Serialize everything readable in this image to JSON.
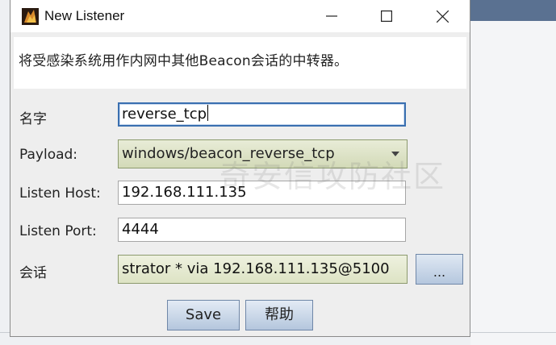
{
  "window": {
    "title": "New Listener",
    "icon": "cobalt-strike-app-icon",
    "controls": [
      "minimize-icon",
      "maximize-icon",
      "close-icon"
    ]
  },
  "description": "将受感染系统用作内网中其他Beacon会话的中转器。",
  "form": {
    "name_label": "名字",
    "name_value": "reverse_tcp",
    "payload_label": "Payload:",
    "payload_value": "windows/beacon_reverse_tcp",
    "listen_host_label": "Listen Host:",
    "listen_host_value": "192.168.111.135",
    "listen_port_label": "Listen Port:",
    "listen_port_value": "4444",
    "session_label": "会话",
    "session_value": "strator * via  192.168.111.135@5100",
    "browse_label": "..."
  },
  "buttons": {
    "save": "Save",
    "help": "帮助"
  },
  "watermark": "奇安信攻防社区",
  "colors": {
    "focus_border": "#3a6fb0",
    "combo_bg": "#d3dab8",
    "button_bg": "#b4c6dd"
  }
}
